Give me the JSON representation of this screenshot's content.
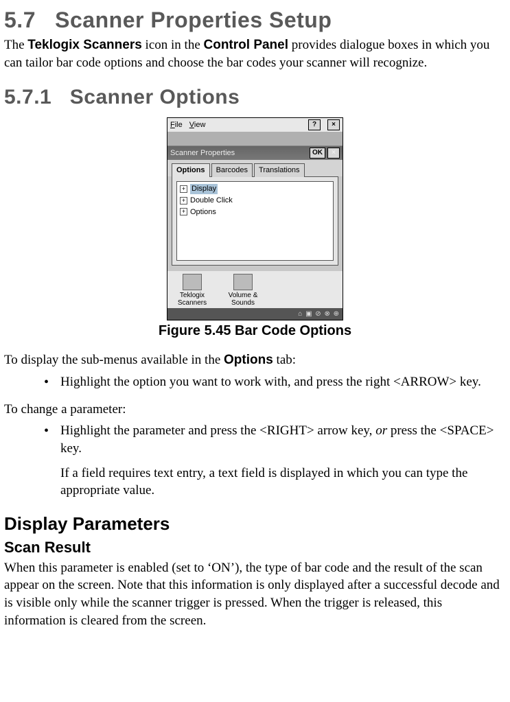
{
  "section": {
    "num": "5.7",
    "title": "Scanner Properties Setup"
  },
  "intro": {
    "prefix": "The ",
    "bold1": "Teklogix Scanners",
    "mid": " icon in the ",
    "bold2": "Control Panel",
    "suffix": " provides dialogue boxes in which you can tailor bar code options and choose the bar codes your scanner will recognize."
  },
  "subsection": {
    "num": "5.7.1",
    "title": "Scanner Options"
  },
  "screenshot": {
    "menu": {
      "file": "File",
      "view": "View",
      "help": "?",
      "close": "×"
    },
    "window_title": "Scanner Properties",
    "ok": "OK",
    "close2": "×",
    "tabs": {
      "options": "Options",
      "barcodes": "Barcodes",
      "translations": "Translations"
    },
    "tree": {
      "display": "Display",
      "double_click": "Double Click",
      "options": "Options"
    },
    "icons": {
      "teklogix1": "Teklogix",
      "teklogix2": "Scanners",
      "vol1": "Volume &",
      "vol2": "Sounds"
    },
    "status": "⌂ ▣  ⊘ ⊗ ⊕"
  },
  "figure_caption": "Figure 5.45 Bar Code Options",
  "p_display_sub": {
    "prefix": "To display the sub-menus available in the ",
    "bold": "Options",
    "suffix": " tab:"
  },
  "bullet1": "Highlight the option you want to work with, and press the right <ARROW> key.",
  "p_change": "To change a parameter:",
  "bullet2": {
    "prefix": "Highlight the parameter and press the <RIGHT> arrow key, ",
    "italic": "or",
    "suffix": " press the <SPACE> key."
  },
  "bullet2_sub": "If a field requires text entry, a text field is displayed in which you can type the appropriate value.",
  "display_params": "Display Parameters",
  "scan_result": "Scan Result",
  "scan_result_body": "When this parameter is enabled (set to ‘ON’), the type of bar code and the result of the scan appear on the screen. Note that this information is only displayed after a successful decode and is visible only while the scanner trigger is pressed. When the trigger is released, this information is cleared from the screen."
}
